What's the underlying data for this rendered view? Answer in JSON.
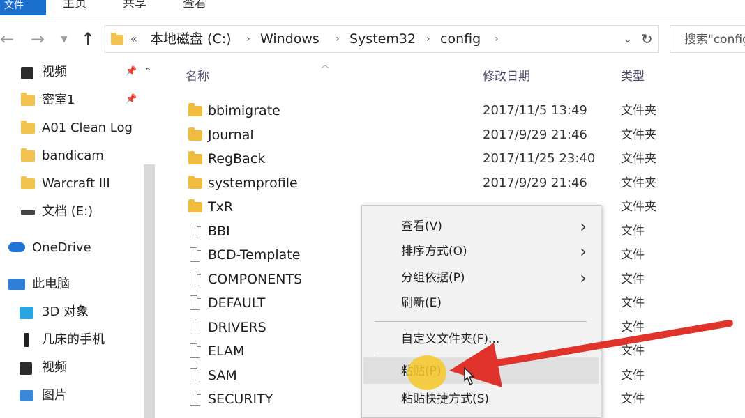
{
  "ribbon": {
    "tabs": [
      {
        "label": "文件"
      },
      {
        "label": "主页"
      },
      {
        "label": "共享"
      },
      {
        "label": "查看"
      }
    ]
  },
  "addressbar": {
    "breadcrumbs": [
      "本地磁盘 (C:)",
      "Windows",
      "System32",
      "config"
    ],
    "overflow": "«",
    "search_placeholder": "搜索\"config\""
  },
  "navpane": {
    "items": [
      {
        "label": "视频",
        "icon": "video-icon",
        "pinned": true
      },
      {
        "label": "密室1",
        "icon": "folder-icon",
        "pinned": true
      },
      {
        "label": "A01 Clean Log",
        "icon": "folder-icon"
      },
      {
        "label": "bandicam",
        "icon": "folder-icon"
      },
      {
        "label": "Warcraft III",
        "icon": "folder-icon"
      },
      {
        "label": "文档 (E:)",
        "icon": "drive-icon"
      },
      {
        "label": "OneDrive",
        "icon": "cloud-icon"
      },
      {
        "label": "此电脑",
        "icon": "computer-icon"
      },
      {
        "label": "3D 对象",
        "icon": "cube-icon"
      },
      {
        "label": "几床的手机",
        "icon": "phone-icon"
      },
      {
        "label": "视频",
        "icon": "video-icon"
      },
      {
        "label": "图片",
        "icon": "picture-icon"
      }
    ]
  },
  "filelist": {
    "columns": {
      "name": "名称",
      "date": "修改日期",
      "type": "类型"
    },
    "rows": [
      {
        "name": "bbimigrate",
        "date": "2017/11/5 13:49",
        "type": "文件夹",
        "kind": "folder"
      },
      {
        "name": "Journal",
        "date": "2017/9/29 21:46",
        "type": "文件夹",
        "kind": "folder"
      },
      {
        "name": "RegBack",
        "date": "2017/11/25 23:40",
        "type": "文件夹",
        "kind": "folder"
      },
      {
        "name": "systemprofile",
        "date": "2017/9/29 21:46",
        "type": "文件夹",
        "kind": "folder"
      },
      {
        "name": "TxR",
        "date": "",
        "type": "文件夹",
        "kind": "folder"
      },
      {
        "name": "BBI",
        "date": "",
        "type": "文件",
        "kind": "file"
      },
      {
        "name": "BCD-Template",
        "date": "",
        "type": "文件",
        "kind": "file"
      },
      {
        "name": "COMPONENTS",
        "date": "",
        "type": "文件",
        "kind": "file"
      },
      {
        "name": "DEFAULT",
        "date": "",
        "type": "文件",
        "kind": "file"
      },
      {
        "name": "DRIVERS",
        "date": "",
        "type": "文件",
        "kind": "file"
      },
      {
        "name": "ELAM",
        "date": "",
        "type": "文件",
        "kind": "file"
      },
      {
        "name": "SAM",
        "date": "",
        "type": "文件",
        "kind": "file"
      },
      {
        "name": "SECURITY",
        "date": "",
        "type": "文件",
        "kind": "file"
      }
    ]
  },
  "contextmenu": {
    "items": [
      {
        "label": "查看(V)",
        "submenu": true
      },
      {
        "label": "排序方式(O)",
        "submenu": true
      },
      {
        "label": "分组依据(P)",
        "submenu": true
      },
      {
        "label": "刷新(E)",
        "submenu": false
      },
      {
        "label": "自定义文件夹(F)...",
        "submenu": false
      },
      {
        "label": "粘贴(P)",
        "submenu": false,
        "highlighted": true
      },
      {
        "label": "粘贴快捷方式(S)",
        "submenu": false
      }
    ]
  },
  "colors": {
    "accent": "#1a6fcf",
    "folder": "#f2bc3e",
    "annotation_arrow": "#e0332b",
    "annotation_highlight": "#f6c828"
  }
}
